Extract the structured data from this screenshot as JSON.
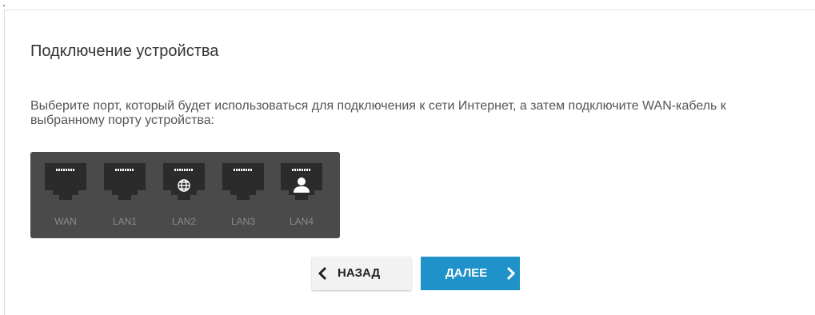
{
  "page": {
    "title": "Подключение устройства",
    "description": "Выберите порт, который будет использоваться для подключения к сети Интернет, а затем подключите WAN-кабель к выбранному порту устройства:"
  },
  "ports": [
    {
      "label": "WAN",
      "icon": "none"
    },
    {
      "label": "LAN1",
      "icon": "none"
    },
    {
      "label": "LAN2",
      "icon": "globe-icon"
    },
    {
      "label": "LAN3",
      "icon": "none"
    },
    {
      "label": "LAN4",
      "icon": "user-icon"
    }
  ],
  "buttons": {
    "back_label": "НАЗАД",
    "next_label": "ДАЛЕЕ"
  },
  "colors": {
    "panel": "#4a4a4a",
    "socket": "#2b2b2b",
    "pins": "#ffffff",
    "port_label": "#8a8a8a",
    "next_button": "#1f93c9",
    "back_button": "#f2f2f2"
  }
}
